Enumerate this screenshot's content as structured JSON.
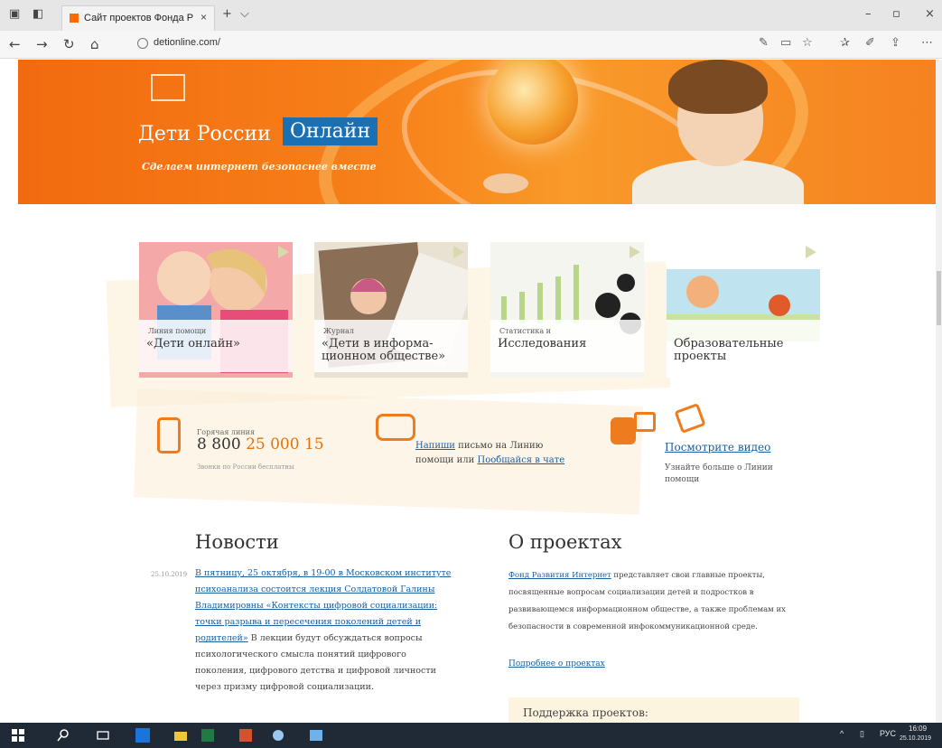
{
  "browser": {
    "tab_title": "Сайт проектов Фонда Р",
    "tab_close": "×",
    "new_tab": "+",
    "tab_menu": "⌵",
    "minimize": "–",
    "maximize": "▫",
    "close": "×",
    "url": "detionline.com/",
    "nav_back": "←",
    "nav_forward": "→",
    "nav_refresh": "↻",
    "nav_home": "⌂"
  },
  "banner": {
    "title": "Дети России",
    "title_highlight": "Онлайн",
    "subtitle": "Сделаем интернет безопаснее вместе"
  },
  "cards": [
    {
      "kicker": "Линия помощи",
      "title": "«Дети онлайн»"
    },
    {
      "kicker": "Журнал",
      "title": "«Дети в информа-ционном обществе»"
    },
    {
      "kicker": "Статистика и",
      "title": "Исследования"
    },
    {
      "kicker": "",
      "title": "Образовательные проекты"
    }
  ],
  "hotline": {
    "label": "Горячая линия",
    "number_prefix": "8 800",
    "number_main": "25 000 15",
    "sub": "Звонки по России бесплатны"
  },
  "write": {
    "link1": "Напиши",
    "text1": " письмо на Линию помощи или ",
    "link2": "Пообщайся в чате"
  },
  "video": {
    "link": "Посмотрите видео",
    "sub": "Узнайте больше о Линии помощи"
  },
  "news": {
    "heading": "Новости",
    "date": "25.10.2019",
    "link_text": "В пятницу, 25 октября, в 19-00 в Московском институте психоанализа состоится лекция Солдатовой Галины Владимировны «Контексты цифровой социализации: точки разрыва и пересечения поколений детей и родителей»",
    "body": " В лекции будут обсуждаться вопросы психологического смысла понятий цифрового поколения, цифрового детства и цифровой личности через призму цифровой социализации."
  },
  "about": {
    "heading": "О проектах",
    "link": "Фонд Развития Интернет",
    "body": " представляет свои главные проекты, посвященные вопросам социализации детей и подростков в развивающемся информационном обществе, а также проблемам их безопасности в современной инфокоммуникационной среде.",
    "more_link": "Подробнее о проектах",
    "support_title": "Поддержка проектов:"
  },
  "taskbar": {
    "lang": "РУС",
    "time": "16:09",
    "date": "25.10.2019"
  },
  "colors": {
    "accent_orange": "#ee7c1e",
    "brand_blue": "#1b6fb3",
    "link_blue": "#1a5fa0"
  }
}
